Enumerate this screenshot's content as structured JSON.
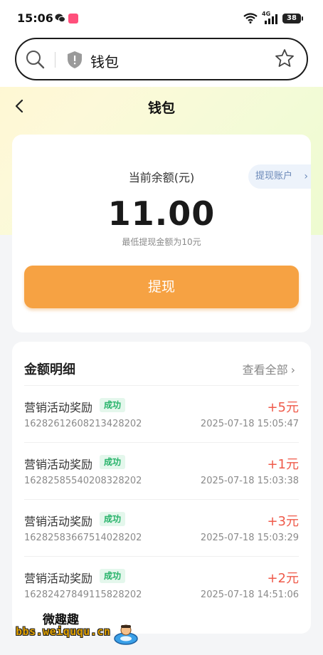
{
  "status_bar": {
    "time": "15:06",
    "network": "4G",
    "battery": "38"
  },
  "search": {
    "text": "钱包"
  },
  "nav": {
    "title": "钱包"
  },
  "balance": {
    "label": "当前余额(元)",
    "account_link": "提现账户",
    "amount": "11.00",
    "min_note": "最低提现金额为10元",
    "withdraw_label": "提现"
  },
  "details": {
    "title": "金额明细",
    "view_all": "查看全部",
    "items": [
      {
        "name": "营销活动奖励",
        "status": "成功",
        "id": "16282612608213428202",
        "amount": "+5元",
        "date": "2025-07-18 15:05:47"
      },
      {
        "name": "营销活动奖励",
        "status": "成功",
        "id": "16282585540208328202",
        "amount": "+1元",
        "date": "2025-07-18 15:03:38"
      },
      {
        "name": "营销活动奖励",
        "status": "成功",
        "id": "16282583667514028202",
        "amount": "+3元",
        "date": "2025-07-18 15:03:29"
      },
      {
        "name": "营销活动奖励",
        "status": "成功",
        "id": "16282427849115828202",
        "amount": "+2元",
        "date": "2025-07-18 14:51:06"
      }
    ]
  },
  "watermark": {
    "top": "微趣趣",
    "bottom": "bbs.weiququ.cn"
  },
  "colors": {
    "accent": "#f6a243",
    "positive_amount": "#ef5a4a",
    "success_tag": "#27b36a",
    "link": "#6a88b8"
  },
  "icons": [
    "search-icon",
    "shield-icon",
    "star-icon",
    "back-icon",
    "chevron-right-icon",
    "wifi-icon",
    "signal-icon",
    "battery-icon",
    "wechat-icon"
  ]
}
